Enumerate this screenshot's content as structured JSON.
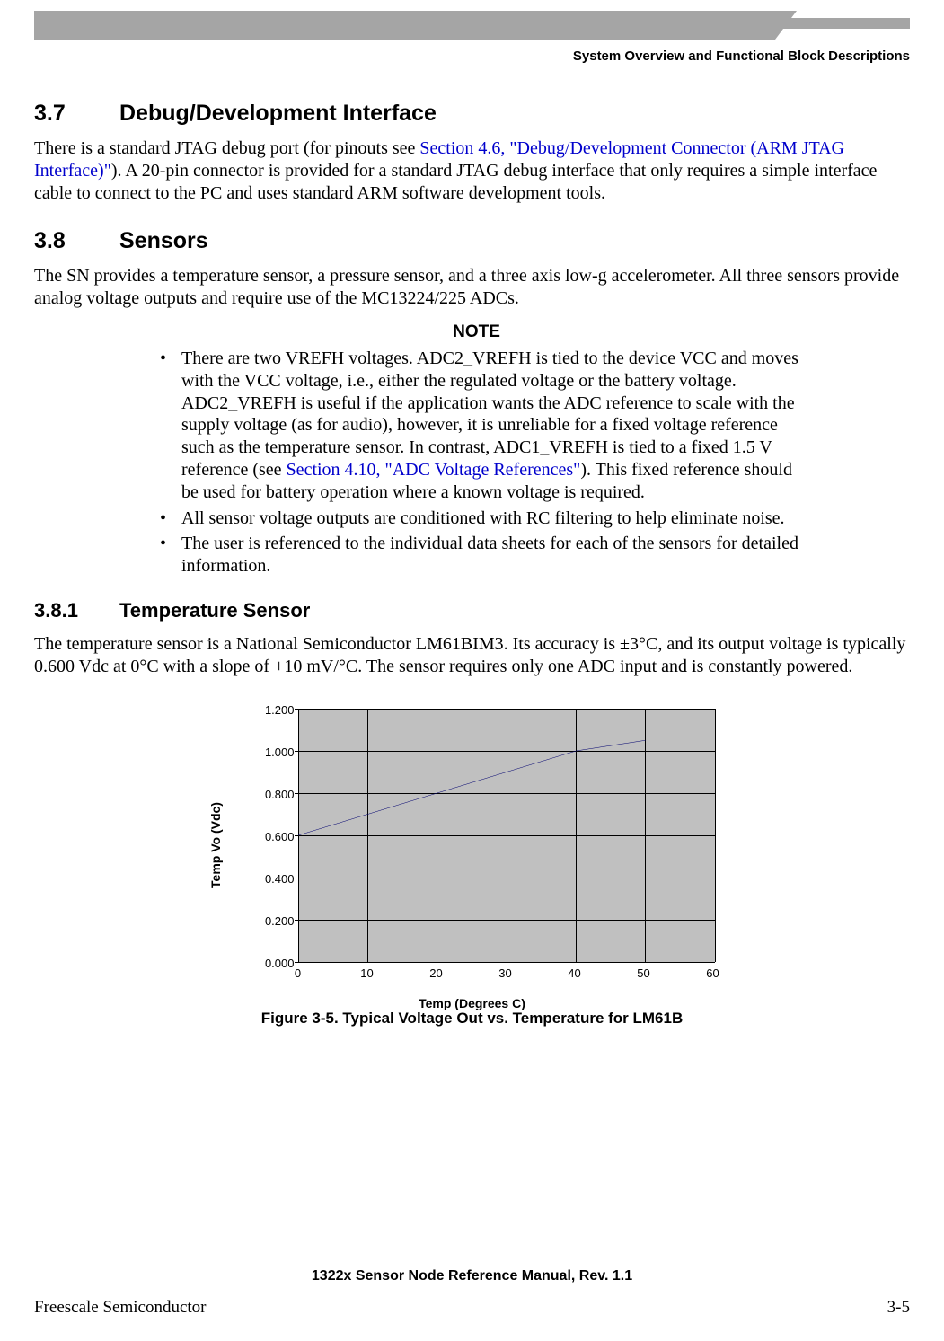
{
  "header": {
    "right": "System Overview and Functional Block Descriptions"
  },
  "sec37": {
    "num": "3.7",
    "title": "Debug/Development Interface",
    "para_a": "There is a standard JTAG debug port (for pinouts see ",
    "para_link": "Section 4.6, \"Debug/Development Connector (ARM JTAG Interface)\"",
    "para_b": "). A 20-pin connector is provided for a standard JTAG debug interface that only requires a simple interface cable to connect to the PC and uses standard ARM software development tools."
  },
  "sec38": {
    "num": "3.8",
    "title": "Sensors",
    "para": "The SN provides a temperature sensor, a pressure sensor, and a three axis low-g accelerometer. All three sensors provide analog voltage outputs and require use of the MC13224/225 ADCs.",
    "note_title": "NOTE",
    "notes": {
      "n1a": "There are two VREFH voltages. ADC2_VREFH is tied to the device VCC and moves with the VCC voltage, i.e., either the regulated voltage or the battery voltage. ADC2_VREFH is useful if the application wants the ADC reference to scale with the supply voltage (as for audio), however, it is unreliable for a fixed voltage reference such as the temperature sensor. In contrast, ADC1_VREFH is tied to a fixed 1.5 V reference (see ",
      "n1link": "Section 4.10, \"ADC Voltage References\"",
      "n1b": "). This fixed reference should be used for battery operation where a known voltage is required.",
      "n2": "All sensor voltage outputs are conditioned with RC filtering to help eliminate noise.",
      "n3": "The user is referenced to the individual data sheets for each of the sensors for detailed information."
    }
  },
  "sec381": {
    "num": "3.8.1",
    "title": "Temperature Sensor",
    "para": "The temperature sensor is a National Semiconductor LM61BIM3. Its accuracy is ±3°C, and its output voltage is typically 0.600 Vdc at 0°C with a slope of +10 mV/°C. The sensor requires only one ADC input and is constantly powered."
  },
  "figure": {
    "caption": "Figure 3-5. Typical Voltage Out vs. Temperature for LM61B",
    "ylabel": "Temp Vo (Vdc)",
    "xlabel": "Temp (Degrees C)"
  },
  "footer": {
    "title": "1322x Sensor Node Reference Manual, Rev. 1.1",
    "left": "Freescale Semiconductor",
    "right": "3-5"
  },
  "chart_data": {
    "type": "line",
    "title": "Typical Voltage Out vs. Temperature for LM61B",
    "xlabel": "Temp (Degrees C)",
    "ylabel": "Temp Vo (Vdc)",
    "xlim": [
      0,
      60
    ],
    "ylim": [
      0.0,
      1.2
    ],
    "x": [
      0,
      10,
      20,
      30,
      40,
      50
    ],
    "values": [
      0.6,
      0.7,
      0.8,
      0.9,
      1.0,
      1.05
    ],
    "xticks": [
      "0",
      "10",
      "20",
      "30",
      "40",
      "50",
      "60"
    ],
    "yticks": [
      "0.000",
      "0.200",
      "0.400",
      "0.600",
      "0.800",
      "1.000",
      "1.200"
    ]
  }
}
